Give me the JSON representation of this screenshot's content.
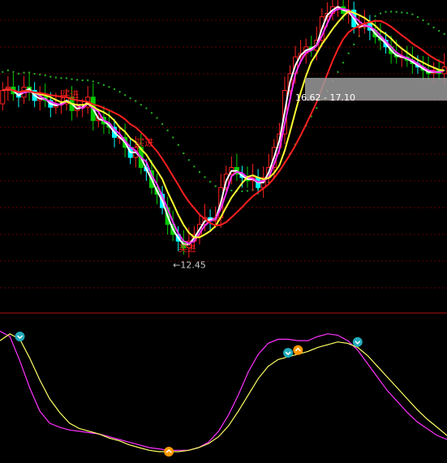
{
  "chart_data": [
    {
      "type": "candlestick",
      "panel": "price",
      "ylim": [
        11.0,
        20.2
      ],
      "grid": true,
      "x": [
        0,
        1,
        2,
        3,
        4,
        5,
        6,
        7,
        8,
        9,
        10,
        11,
        12,
        13,
        14,
        15,
        16,
        17,
        18,
        19,
        20,
        21,
        22,
        23,
        24,
        25,
        26,
        27,
        28,
        29,
        30,
        31,
        32,
        33,
        34,
        35,
        36,
        37,
        38,
        39,
        40,
        41,
        42,
        43,
        44,
        45,
        46,
        47,
        48,
        49,
        50,
        51,
        52,
        53,
        54,
        55,
        56,
        57,
        58,
        59,
        60,
        61,
        62,
        63,
        64,
        65,
        66,
        67,
        68,
        69,
        70,
        71,
        72,
        73,
        74,
        75,
        76,
        77,
        78,
        79,
        80,
        81,
        82,
        83
      ],
      "open": [
        17.1,
        17.5,
        17.6,
        17.4,
        17.3,
        17.6,
        17.5,
        17.2,
        17.3,
        17.2,
        17.0,
        17.1,
        17.1,
        17.3,
        16.9,
        17.0,
        17.0,
        17.3,
        16.6,
        16.7,
        16.5,
        16.4,
        16.1,
        16.1,
        15.8,
        15.5,
        15.8,
        15.2,
        15.1,
        14.6,
        14.4,
        14.0,
        13.5,
        13.2,
        13.0,
        12.8,
        13.0,
        13.2,
        13.5,
        13.7,
        13.6,
        13.7,
        14.6,
        15.0,
        15.2,
        15.0,
        14.9,
        14.8,
        14.9,
        14.6,
        14.9,
        15.2,
        15.8,
        16.2,
        17.5,
        18.0,
        18.5,
        18.6,
        18.8,
        18.7,
        19.0,
        19.7,
        19.8,
        20.0,
        20.0,
        19.8,
        19.9,
        19.4,
        19.4,
        19.5,
        19.3,
        19.1,
        19.0,
        18.8,
        18.6,
        18.5,
        18.5,
        18.4,
        18.3,
        18.2,
        18.1,
        18.0,
        18.1,
        18.0
      ],
      "close": [
        17.5,
        17.6,
        17.4,
        17.3,
        17.6,
        17.5,
        17.2,
        17.3,
        17.2,
        17.0,
        17.1,
        17.1,
        17.3,
        16.9,
        17.0,
        17.0,
        17.3,
        16.6,
        16.7,
        16.5,
        16.4,
        16.1,
        16.1,
        15.8,
        15.5,
        15.8,
        15.2,
        15.1,
        14.6,
        14.4,
        14.0,
        13.5,
        13.2,
        13.0,
        12.8,
        13.0,
        13.2,
        13.5,
        13.7,
        13.6,
        13.7,
        14.6,
        15.0,
        15.2,
        15.0,
        14.9,
        14.8,
        14.9,
        14.6,
        14.9,
        15.2,
        15.8,
        16.2,
        17.5,
        18.0,
        18.5,
        18.6,
        18.8,
        18.7,
        19.0,
        19.7,
        19.8,
        20.0,
        20.0,
        19.8,
        19.9,
        19.4,
        19.4,
        19.5,
        19.3,
        19.1,
        19.0,
        18.8,
        18.6,
        18.5,
        18.5,
        18.4,
        18.3,
        18.2,
        18.1,
        18.0,
        18.1,
        18.0,
        18.2
      ],
      "annotations": [
        {
          "text": "买进",
          "x": 11,
          "y": 17.3,
          "color": "#ff2020"
        },
        {
          "text": "买进",
          "x": 25,
          "y": 15.85,
          "color": "#ff2020"
        },
        {
          "text": "买进",
          "x": 33,
          "y": 12.7,
          "color": "#ff2020"
        },
        {
          "text": "←12.45",
          "x": 32,
          "y": 12.2,
          "color": "#cccccc"
        },
        {
          "text": "16.62 - 17.10",
          "x": 55,
          "y": 17.2,
          "color": "#ffffff"
        }
      ],
      "colors": {
        "up": "#ff2020",
        "down": "#00ffff",
        "bear": "#00cc00",
        "ma_white": "#ffffff",
        "ma_magenta": "#ff33ff",
        "ma_yellow": "#ffff33",
        "ma_red": "#ff2020",
        "dots": "#22aa22"
      }
    },
    {
      "type": "line",
      "panel": "oscillator",
      "ylim": [
        0,
        100
      ],
      "series": [
        {
          "color": "#ff33ff",
          "values": [
            92,
            88,
            70,
            50,
            33,
            24,
            21,
            19,
            18,
            17,
            16,
            14,
            12,
            10,
            8,
            6,
            5,
            4,
            4,
            4,
            6,
            10,
            18,
            30,
            45,
            62,
            75,
            83,
            86,
            86,
            85,
            85,
            88,
            90,
            89,
            85,
            78,
            68,
            58,
            48,
            40,
            32,
            25,
            20,
            15,
            12
          ]
        },
        {
          "color": "#ffff66",
          "values": [
            85,
            90,
            86,
            72,
            56,
            42,
            32,
            24,
            20,
            18,
            16,
            13,
            11,
            8,
            6,
            4,
            3,
            3,
            3,
            4,
            6,
            9,
            14,
            22,
            33,
            45,
            57,
            66,
            71,
            73,
            75,
            77,
            80,
            82,
            84,
            83,
            80,
            74,
            66,
            58,
            50,
            42,
            34,
            27,
            21,
            15
          ]
        }
      ],
      "markers": [
        {
          "x": 2,
          "y": 88,
          "kind": "down",
          "color": "#22aabb"
        },
        {
          "x": 17,
          "y": 3,
          "kind": "up",
          "color": "#ff9900"
        },
        {
          "x": 29,
          "y": 76,
          "kind": "down",
          "color": "#22aabb"
        },
        {
          "x": 30,
          "y": 78,
          "kind": "up",
          "color": "#ff9900"
        },
        {
          "x": 36,
          "y": 84,
          "kind": "down",
          "color": "#22aabb"
        }
      ]
    }
  ]
}
